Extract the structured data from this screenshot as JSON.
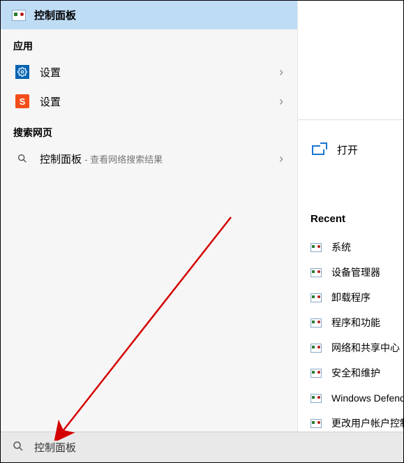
{
  "bestmatch": {
    "label": "控制面板"
  },
  "sections": {
    "apps": {
      "header": "应用",
      "items": [
        {
          "kind": "gear",
          "label": "设置"
        },
        {
          "kind": "sogou",
          "label": "设置"
        }
      ]
    },
    "web": {
      "header": "搜索网页",
      "item": {
        "label": "控制面板",
        "sub": "- 查看网络搜索结果"
      }
    }
  },
  "right": {
    "open_label": "打开",
    "recent_header": "Recent",
    "recent": [
      "系统",
      "设备管理器",
      "卸载程序",
      "程序和功能",
      "网络和共享中心",
      "安全和维护",
      "Windows Defender 防火墙",
      "更改用户帐户控制设置"
    ]
  },
  "search": {
    "value": "控制面板"
  }
}
